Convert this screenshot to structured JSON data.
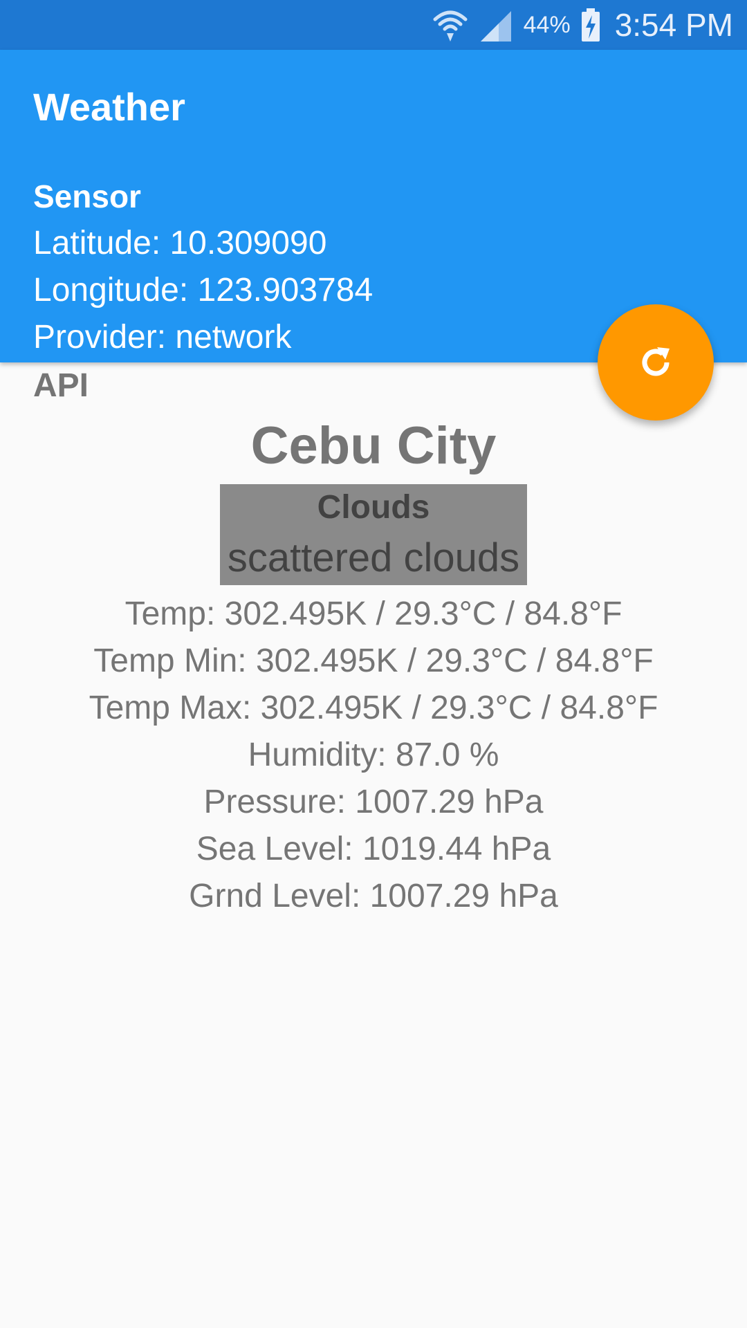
{
  "status_bar": {
    "battery_percent": "44%",
    "time": "3:54 PM",
    "icons": [
      "wifi-icon",
      "signal-icon",
      "battery-charging-icon"
    ]
  },
  "app": {
    "title": "Weather"
  },
  "sensor": {
    "heading": "Sensor",
    "latitude": "Latitude: 10.309090",
    "longitude": "Longitude: 123.903784",
    "provider": "Provider: network"
  },
  "fab": {
    "icon": "refresh-icon",
    "color": "#ff9800"
  },
  "api": {
    "heading": "API",
    "city": "Cebu City",
    "condition_main": "Clouds",
    "condition_description": "scattered clouds",
    "details": [
      "Temp: 302.495K / 29.3°C / 84.8°F",
      "Temp Min: 302.495K / 29.3°C / 84.8°F",
      "Temp Max: 302.495K / 29.3°C / 84.8°F",
      "Humidity: 87.0 %",
      "Pressure: 1007.29 hPa",
      "Sea Level: 1019.44 hPa",
      "Grnd Level: 1007.29 hPa"
    ]
  },
  "colors": {
    "status_bar": "#1e78d2",
    "app_bar": "#2196f3",
    "accent": "#ff9800",
    "background": "#fafafa",
    "condition_box": "#8a8a8a"
  }
}
